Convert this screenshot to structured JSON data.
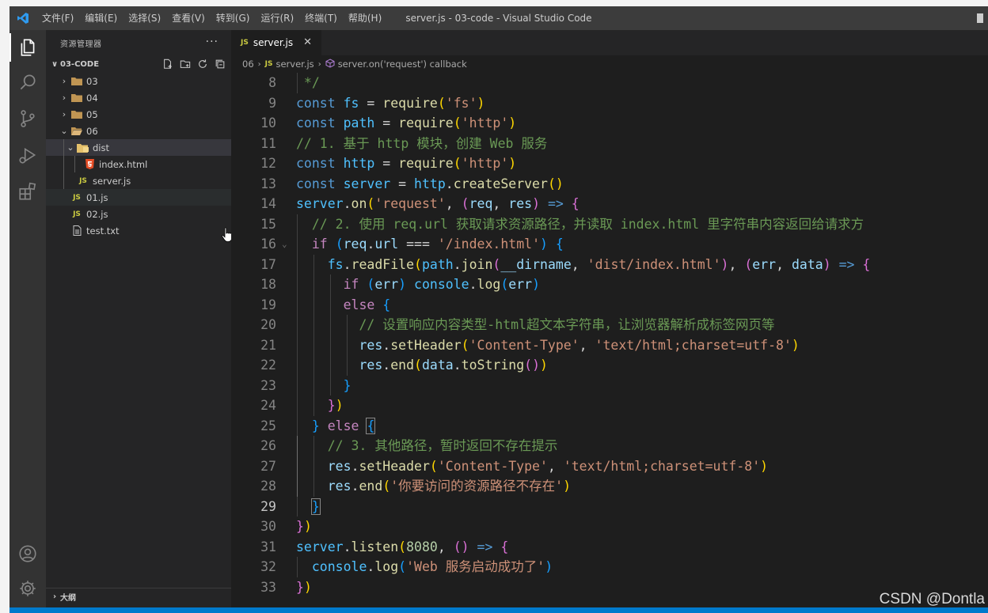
{
  "titlebar": {
    "menu": [
      "文件(F)",
      "编辑(E)",
      "选择(S)",
      "查看(V)",
      "转到(G)",
      "运行(R)",
      "终端(T)",
      "帮助(H)"
    ],
    "title": "server.js - 03-code - Visual Studio Code"
  },
  "sidebar": {
    "header": "资源管理器",
    "more": "···",
    "section": "03-CODE",
    "tree": [
      {
        "label": "03",
        "type": "folder",
        "depth": 0,
        "expanded": false
      },
      {
        "label": "04",
        "type": "folder",
        "depth": 0,
        "expanded": false
      },
      {
        "label": "05",
        "type": "folder",
        "depth": 0,
        "expanded": false
      },
      {
        "label": "06",
        "type": "folder",
        "depth": 0,
        "expanded": true
      },
      {
        "label": "dist",
        "type": "folder",
        "depth": 1,
        "expanded": true
      },
      {
        "label": "index.html",
        "type": "html",
        "depth": 2
      },
      {
        "label": "server.js",
        "type": "js",
        "depth": 1
      },
      {
        "label": "01.js",
        "type": "js",
        "depth": 0
      },
      {
        "label": "02.js",
        "type": "js",
        "depth": 0
      },
      {
        "label": "test.txt",
        "type": "txt",
        "depth": 0
      }
    ],
    "outline": "大纲"
  },
  "editor": {
    "tab": {
      "icon": "JS",
      "label": "server.js",
      "close": "✕"
    },
    "breadcrumb": {
      "folder": "06",
      "file": "server.js",
      "symbol": "server.on('request') callback"
    },
    "lines": [
      {
        "n": "8",
        "t": [
          [
            "c",
            " */"
          ]
        ]
      },
      {
        "n": "9",
        "t": [
          [
            "k",
            "const "
          ],
          [
            "v",
            "fs"
          ],
          [
            "p",
            " = "
          ],
          [
            "f",
            "require"
          ],
          [
            "b1",
            "("
          ],
          [
            "s",
            "'fs'"
          ],
          [
            "b1",
            ")"
          ]
        ]
      },
      {
        "n": "10",
        "t": [
          [
            "k",
            "const "
          ],
          [
            "v",
            "path"
          ],
          [
            "p",
            " = "
          ],
          [
            "f",
            "require"
          ],
          [
            "b1",
            "("
          ],
          [
            "s",
            "'http'"
          ],
          [
            "b1",
            ")"
          ]
        ]
      },
      {
        "n": "11",
        "t": [
          [
            "c",
            "// 1. 基于 http 模块，创建 Web 服务"
          ]
        ]
      },
      {
        "n": "12",
        "t": [
          [
            "k",
            "const "
          ],
          [
            "v",
            "http"
          ],
          [
            "p",
            " = "
          ],
          [
            "f",
            "require"
          ],
          [
            "b1",
            "("
          ],
          [
            "s",
            "'http'"
          ],
          [
            "b1",
            ")"
          ]
        ]
      },
      {
        "n": "13",
        "t": [
          [
            "k",
            "const "
          ],
          [
            "v",
            "server"
          ],
          [
            "p",
            " = "
          ],
          [
            "v",
            "http"
          ],
          [
            "p",
            "."
          ],
          [
            "f",
            "createServer"
          ],
          [
            "b1",
            "()"
          ]
        ]
      },
      {
        "n": "14",
        "t": [
          [
            "v",
            "server"
          ],
          [
            "p",
            "."
          ],
          [
            "f",
            "on"
          ],
          [
            "b1",
            "("
          ],
          [
            "s",
            "'request'"
          ],
          [
            "p",
            ", "
          ],
          [
            "b2",
            "("
          ],
          [
            "var",
            "req"
          ],
          [
            "p",
            ", "
          ],
          [
            "var",
            "res"
          ],
          [
            "b2",
            ")"
          ],
          [
            "p",
            " "
          ],
          [
            "k",
            "=>"
          ],
          [
            "p",
            " "
          ],
          [
            "b2",
            "{"
          ]
        ]
      },
      {
        "n": "15",
        "t": [
          [
            "c",
            "  // 2. 使用 req.url 获取请求资源路径，并读取 index.html 里字符串内容返回给请求方"
          ]
        ]
      },
      {
        "n": "16",
        "t": [
          [
            "p",
            "  "
          ],
          [
            "ctl",
            "if"
          ],
          [
            "p",
            " "
          ],
          [
            "b3",
            "("
          ],
          [
            "var",
            "req"
          ],
          [
            "p",
            "."
          ],
          [
            "var",
            "url"
          ],
          [
            "p",
            " === "
          ],
          [
            "s",
            "'/index.html'"
          ],
          [
            "b3",
            ")"
          ],
          [
            "p",
            " "
          ],
          [
            "b3",
            "{"
          ]
        ]
      },
      {
        "n": "17",
        "t": [
          [
            "p",
            "    "
          ],
          [
            "v",
            "fs"
          ],
          [
            "p",
            "."
          ],
          [
            "f",
            "readFile"
          ],
          [
            "b1",
            "("
          ],
          [
            "v",
            "path"
          ],
          [
            "p",
            "."
          ],
          [
            "f",
            "join"
          ],
          [
            "b2",
            "("
          ],
          [
            "var",
            "__dirname"
          ],
          [
            "p",
            ", "
          ],
          [
            "s",
            "'dist/index.html'"
          ],
          [
            "b2",
            ")"
          ],
          [
            "p",
            ", "
          ],
          [
            "b2",
            "("
          ],
          [
            "var",
            "err"
          ],
          [
            "p",
            ", "
          ],
          [
            "var",
            "data"
          ],
          [
            "b2",
            ")"
          ],
          [
            "p",
            " "
          ],
          [
            "k",
            "=>"
          ],
          [
            "p",
            " "
          ],
          [
            "b2",
            "{"
          ]
        ]
      },
      {
        "n": "18",
        "t": [
          [
            "p",
            "      "
          ],
          [
            "ctl",
            "if"
          ],
          [
            "p",
            " "
          ],
          [
            "b3",
            "("
          ],
          [
            "var",
            "err"
          ],
          [
            "b3",
            ")"
          ],
          [
            "p",
            " "
          ],
          [
            "v",
            "console"
          ],
          [
            "p",
            "."
          ],
          [
            "f",
            "log"
          ],
          [
            "b3",
            "("
          ],
          [
            "var",
            "err"
          ],
          [
            "b3",
            ")"
          ]
        ]
      },
      {
        "n": "19",
        "t": [
          [
            "p",
            "      "
          ],
          [
            "ctl",
            "else"
          ],
          [
            "p",
            " "
          ],
          [
            "b3",
            "{"
          ]
        ]
      },
      {
        "n": "20",
        "t": [
          [
            "c",
            "        // 设置响应内容类型-html超文本字符串，让浏览器解析成标签网页等"
          ]
        ]
      },
      {
        "n": "21",
        "t": [
          [
            "p",
            "        "
          ],
          [
            "var",
            "res"
          ],
          [
            "p",
            "."
          ],
          [
            "f",
            "setHeader"
          ],
          [
            "b1",
            "("
          ],
          [
            "s",
            "'Content-Type'"
          ],
          [
            "p",
            ", "
          ],
          [
            "s",
            "'text/html;charset=utf-8'"
          ],
          [
            "b1",
            ")"
          ]
        ]
      },
      {
        "n": "22",
        "t": [
          [
            "p",
            "        "
          ],
          [
            "var",
            "res"
          ],
          [
            "p",
            "."
          ],
          [
            "f",
            "end"
          ],
          [
            "b1",
            "("
          ],
          [
            "var",
            "data"
          ],
          [
            "p",
            "."
          ],
          [
            "f",
            "toString"
          ],
          [
            "b2",
            "()"
          ],
          [
            "b1",
            ")"
          ]
        ]
      },
      {
        "n": "23",
        "t": [
          [
            "p",
            "      "
          ],
          [
            "b3",
            "}"
          ]
        ]
      },
      {
        "n": "24",
        "t": [
          [
            "p",
            "    "
          ],
          [
            "b2",
            "}"
          ],
          [
            "b1",
            ")"
          ]
        ]
      },
      {
        "n": "25",
        "t": [
          [
            "p",
            "  "
          ],
          [
            "b3",
            "}"
          ],
          [
            "p",
            " "
          ],
          [
            "ctl",
            "else"
          ],
          [
            "p",
            " "
          ],
          [
            "b3 bm",
            "{"
          ]
        ]
      },
      {
        "n": "26",
        "t": [
          [
            "c",
            "    // 3. 其他路径，暂时返回不存在提示"
          ]
        ]
      },
      {
        "n": "27",
        "t": [
          [
            "p",
            "    "
          ],
          [
            "var",
            "res"
          ],
          [
            "p",
            "."
          ],
          [
            "f",
            "setHeader"
          ],
          [
            "b1",
            "("
          ],
          [
            "s",
            "'Content-Type'"
          ],
          [
            "p",
            ", "
          ],
          [
            "s",
            "'text/html;charset=utf-8'"
          ],
          [
            "b1",
            ")"
          ]
        ]
      },
      {
        "n": "28",
        "t": [
          [
            "p",
            "    "
          ],
          [
            "var",
            "res"
          ],
          [
            "p",
            "."
          ],
          [
            "f",
            "end"
          ],
          [
            "b1",
            "("
          ],
          [
            "s",
            "'你要访问的资源路径不存在'"
          ],
          [
            "b1",
            ")"
          ]
        ]
      },
      {
        "n": "29",
        "t": [
          [
            "p",
            "  "
          ],
          [
            "b3 bm",
            "}"
          ]
        ]
      },
      {
        "n": "30",
        "t": [
          [
            "b2",
            "}"
          ],
          [
            "b1",
            ")"
          ]
        ]
      },
      {
        "n": "31",
        "t": [
          [
            "v",
            "server"
          ],
          [
            "p",
            "."
          ],
          [
            "f",
            "listen"
          ],
          [
            "b1",
            "("
          ],
          [
            "n",
            "8080"
          ],
          [
            "p",
            ", "
          ],
          [
            "b2",
            "()"
          ],
          [
            "p",
            " "
          ],
          [
            "k",
            "=>"
          ],
          [
            "p",
            " "
          ],
          [
            "b2",
            "{"
          ]
        ]
      },
      {
        "n": "32",
        "t": [
          [
            "p",
            "  "
          ],
          [
            "v",
            "console"
          ],
          [
            "p",
            "."
          ],
          [
            "f",
            "log"
          ],
          [
            "b3",
            "("
          ],
          [
            "s",
            "'Web 服务启动成功了'"
          ],
          [
            "b3",
            ")"
          ]
        ]
      },
      {
        "n": "33",
        "t": [
          [
            "b2",
            "}"
          ],
          [
            "b1",
            ")"
          ]
        ]
      }
    ]
  },
  "watermark": "CSDN @Dontla",
  "colors": {
    "accent": "#007acc",
    "keyword": "#569cd6",
    "string": "#ce9178",
    "comment": "#6a9955",
    "function": "#dcdcaa"
  }
}
